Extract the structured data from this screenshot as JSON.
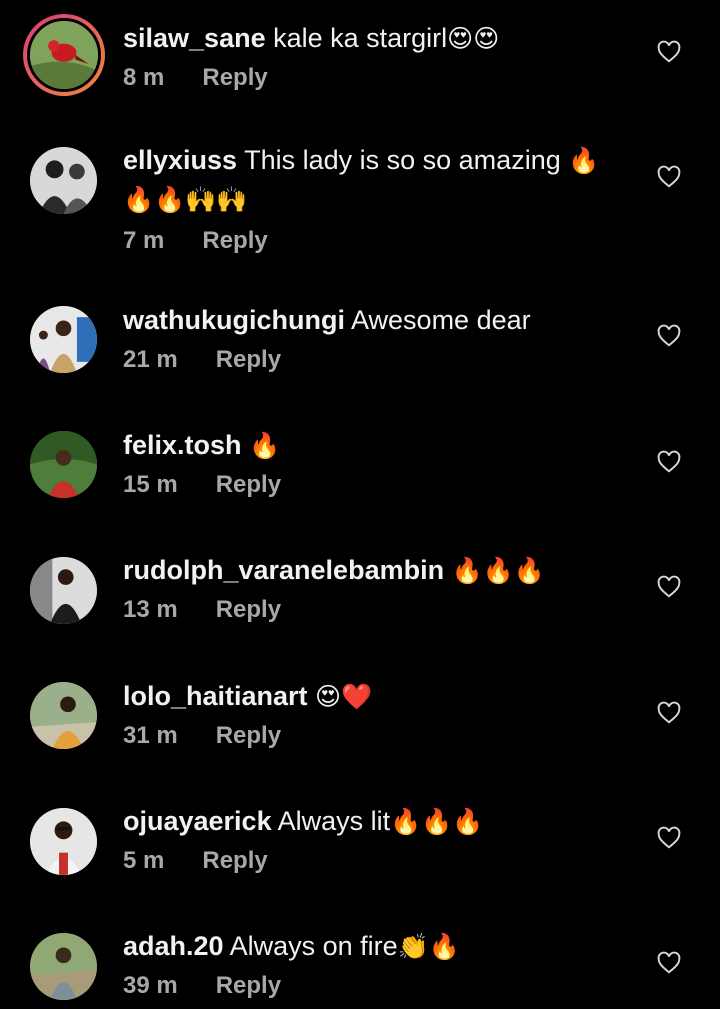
{
  "comments": [
    {
      "user": "silaw_sane",
      "text": " kale ka stargirl",
      "emoji": "😍😍",
      "time": "8 m",
      "reply": "Reply"
    },
    {
      "user": "ellyxiuss",
      "text": " This lady is so so amazing ",
      "emoji": "🔥",
      "line2": "🔥🔥🙌🙌",
      "time": "7 m",
      "reply": "Reply"
    },
    {
      "user": "wathukugichungi",
      "text": " Awesome dear",
      "emoji": "",
      "time": "21 m",
      "reply": "Reply"
    },
    {
      "user": "felix.tosh",
      "text": " ",
      "emoji": "🔥",
      "time": "15 m",
      "reply": "Reply"
    },
    {
      "user": "rudolph_varanelebambin",
      "text": " ",
      "emoji": "🔥🔥🔥",
      "time": "13 m",
      "reply": "Reply"
    },
    {
      "user": "lolo_haitianart",
      "text": " ",
      "emoji": "😍❤️",
      "time": "31 m",
      "reply": "Reply"
    },
    {
      "user": "ojuayaerick",
      "text": " Always lit",
      "emoji": "🔥🔥🔥",
      "time": "5 m",
      "reply": "Reply"
    },
    {
      "user": "adah.20",
      "text": " Always on fire",
      "emoji": "👏🔥",
      "time": "39 m",
      "reply": "Reply"
    }
  ],
  "icons": {
    "like": "heart-outline-icon"
  },
  "colors": {
    "background": "#000000",
    "meta": "#a8a8a8",
    "story_ring_start": "#d93a7a",
    "story_ring_end": "#f08a3e"
  }
}
